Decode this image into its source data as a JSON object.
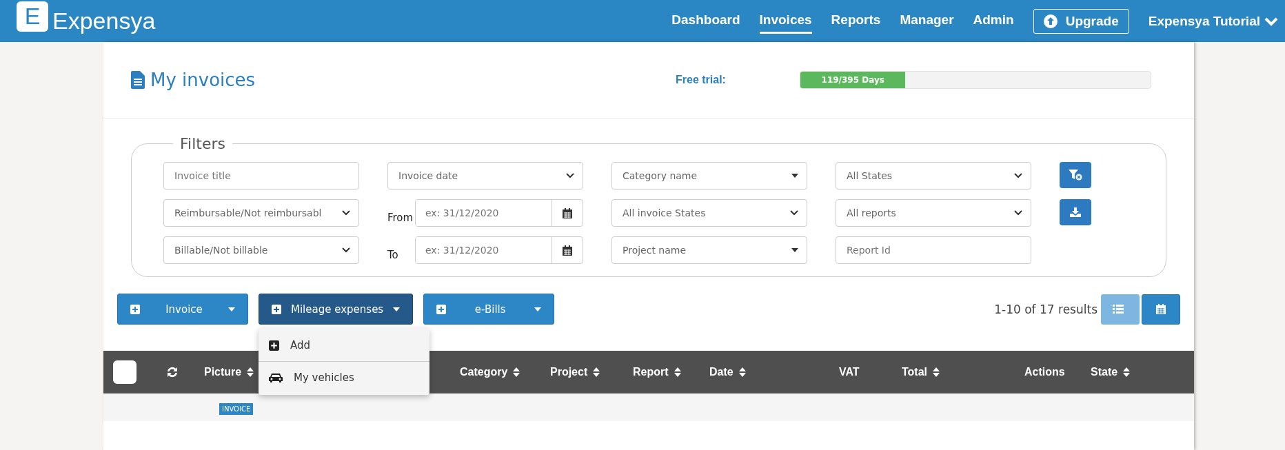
{
  "brand": {
    "logo_letter": "E",
    "name": "Expensya"
  },
  "nav": [
    {
      "label": "Dashboard",
      "selected": false
    },
    {
      "label": "Invoices",
      "selected": true
    },
    {
      "label": "Reports",
      "selected": false
    },
    {
      "label": "Manager",
      "selected": false
    },
    {
      "label": "Admin",
      "selected": false
    }
  ],
  "upgrade_button": "Upgrade",
  "user_menu": "Expensya Tutorial",
  "page": {
    "title": "My invoices",
    "trial_label": "Free trial:",
    "trial": {
      "text": "119/395 Days",
      "level": 0.3
    }
  },
  "filters": {
    "legend": "Filters",
    "rows": [
      [
        {
          "kind": "text",
          "placeholder": "Invoice title"
        },
        {
          "kind": "select",
          "value": "Invoice date"
        },
        {
          "kind": "combo",
          "value": "Category name"
        },
        {
          "kind": "select",
          "value": "All States"
        },
        {
          "kind": "clear"
        }
      ],
      [
        {
          "kind": "select",
          "value": "Reimbursable/Not reimbursabl"
        },
        {
          "kind": "date",
          "label": "From",
          "placeholder": "ex: 31/12/2020"
        },
        {
          "kind": "select",
          "value": "All invoice States"
        },
        {
          "kind": "select",
          "value": "All reports"
        },
        {
          "kind": "download"
        }
      ],
      [
        {
          "kind": "select",
          "value": "Billable/Not billable"
        },
        {
          "kind": "date",
          "label": "To",
          "placeholder": "ex: 31/12/2020"
        },
        {
          "kind": "combo",
          "value": "Project name"
        },
        {
          "kind": "text",
          "placeholder": "Report Id"
        }
      ]
    ]
  },
  "add_buttons": [
    {
      "label": "Invoice",
      "expanded": false
    },
    {
      "label": "Mileage expenses",
      "expanded": true
    },
    {
      "label": "e-Bills",
      "expanded": false
    }
  ],
  "dropdown": [
    {
      "kind": "add",
      "label": "Add"
    },
    {
      "kind": "vehicle",
      "label": "My vehicles"
    }
  ],
  "results": "1-10 of 17 results",
  "view_buttons": [
    {
      "kind": "list",
      "selected": true
    },
    {
      "kind": "calendar",
      "selected": false
    }
  ],
  "table": {
    "columns": [
      {
        "kind": "checkbox",
        "checked": false
      },
      {
        "kind": "refresh"
      },
      {
        "label": "Picture",
        "sortable": true
      },
      {
        "label": "Category",
        "sortable": true
      },
      {
        "label": "Project",
        "sortable": true
      },
      {
        "label": "Report",
        "sortable": true
      },
      {
        "label": "Date",
        "sortable": true
      },
      {
        "label": "VAT",
        "sortable": false
      },
      {
        "label": "Total",
        "sortable": true
      },
      {
        "label": "Actions",
        "sortable": false
      },
      {
        "label": "State",
        "sortable": true
      }
    ],
    "row_tag": "INVOICE"
  }
}
